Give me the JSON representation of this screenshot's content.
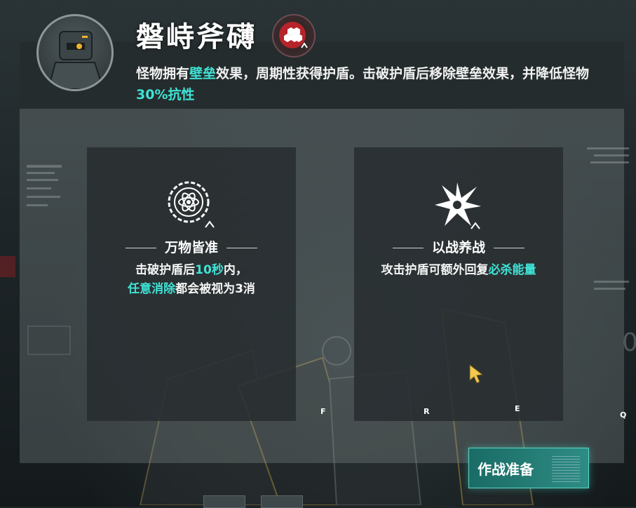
{
  "boss": {
    "name": "磐峙斧礴",
    "desc_parts": [
      "怪物拥有",
      "壁垒",
      "效果，周期性获得护盾。击破护盾后移除壁垒效果，并降低怪物",
      "30%抗性"
    ]
  },
  "cards": [
    {
      "title": "万物皆准",
      "text_parts": [
        "击破护盾后",
        "10秒",
        "内，",
        "任意消除",
        "都会被视为3消"
      ]
    },
    {
      "title": "以战养战",
      "text_parts": [
        "攻击护盾可额外回复",
        "必杀能量"
      ]
    }
  ],
  "keys": [
    "F",
    "R",
    "E",
    "Q"
  ],
  "start_button": {
    "label": "作战准备"
  },
  "colors": {
    "accent": "#3fe3d6",
    "button": "#2e8c84",
    "badge": "#c0262e"
  }
}
